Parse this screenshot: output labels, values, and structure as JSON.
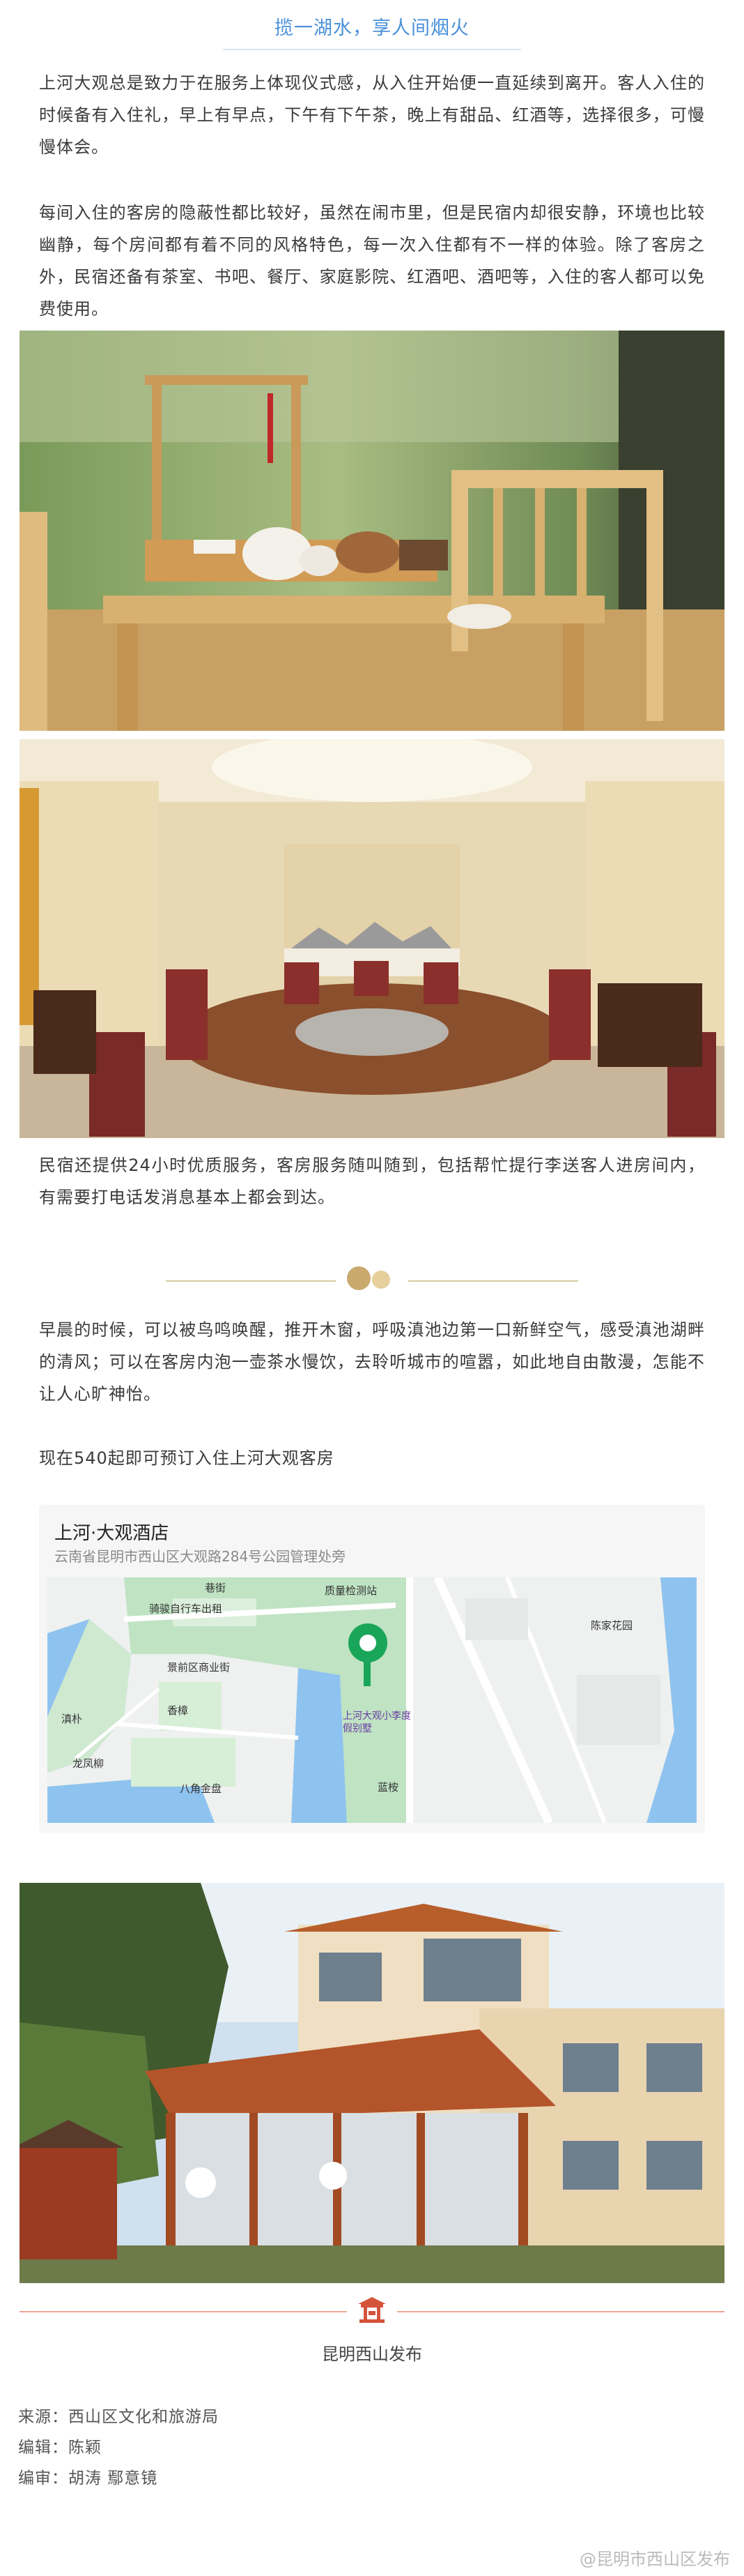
{
  "header": {
    "title": "揽一湖水，享人间烟火"
  },
  "paragraphs": {
    "p1": "上河大观总是致力于在服务上体现仪式感，从入住开始便一直延续到离开。客人入住的时候备有入住礼，早上有早点，下午有下午茶，晚上有甜品、红酒等，选择很多，可慢慢体会。",
    "p2": "每间入住的客房的隐蔽性都比较好，虽然在闹市里，但是民宿内却很安静，环境也比较幽静，每个房间都有着不同的风格特色，每一次入住都有不一样的体验。除了客房之外，民宿还备有茶室、书吧、餐厅、家庭影院、红酒吧、酒吧等，入住的客人都可以免费使用。",
    "p3": "民宿还提供24小时优质服务，客房服务随叫随到，包括帮忙提行李送客人进房间内，有需要打电话发消息基本上都会到达。",
    "p4": "早晨的时候，可以被鸟鸣唤醒，推开木窗，呼吸滇池边第一口新鲜空气，感受滇池湖畔的清风；可以在客房内泡一壶茶水慢饮，去聆听城市的喧嚣，如此地自由散漫，怎能不让人心旷神怡。",
    "p5": "现在540起即可预订入住上河大观客房"
  },
  "map": {
    "name": "上河·大观酒店",
    "address": "云南省昆明市西山区大观路284号公园管理处旁",
    "labels": {
      "bike": "骑骏自行车出租",
      "inspect": "质量检测站",
      "garden": "陈家花园",
      "xiangjie": "巷街",
      "jingqu": "景前区商业街",
      "xiangzhang": "香樟",
      "haipu": "滇朴",
      "longfeng": "龙凤柳",
      "bajiao": "八角金盘",
      "lanshu": "蓝桉",
      "hotel": "上河大观小李度假别墅"
    }
  },
  "footer": {
    "brand": "昆明西山发布",
    "source": "来源：西山区文化和旅游局",
    "editor": "编辑：陈颖",
    "reviewer": "编审：胡涛  鄢意镜",
    "watermark": "@昆明市西山区发布"
  },
  "colors": {
    "accent": "#4a90d9",
    "gold": "#c9a96e",
    "footer_red": "#d4533b"
  }
}
